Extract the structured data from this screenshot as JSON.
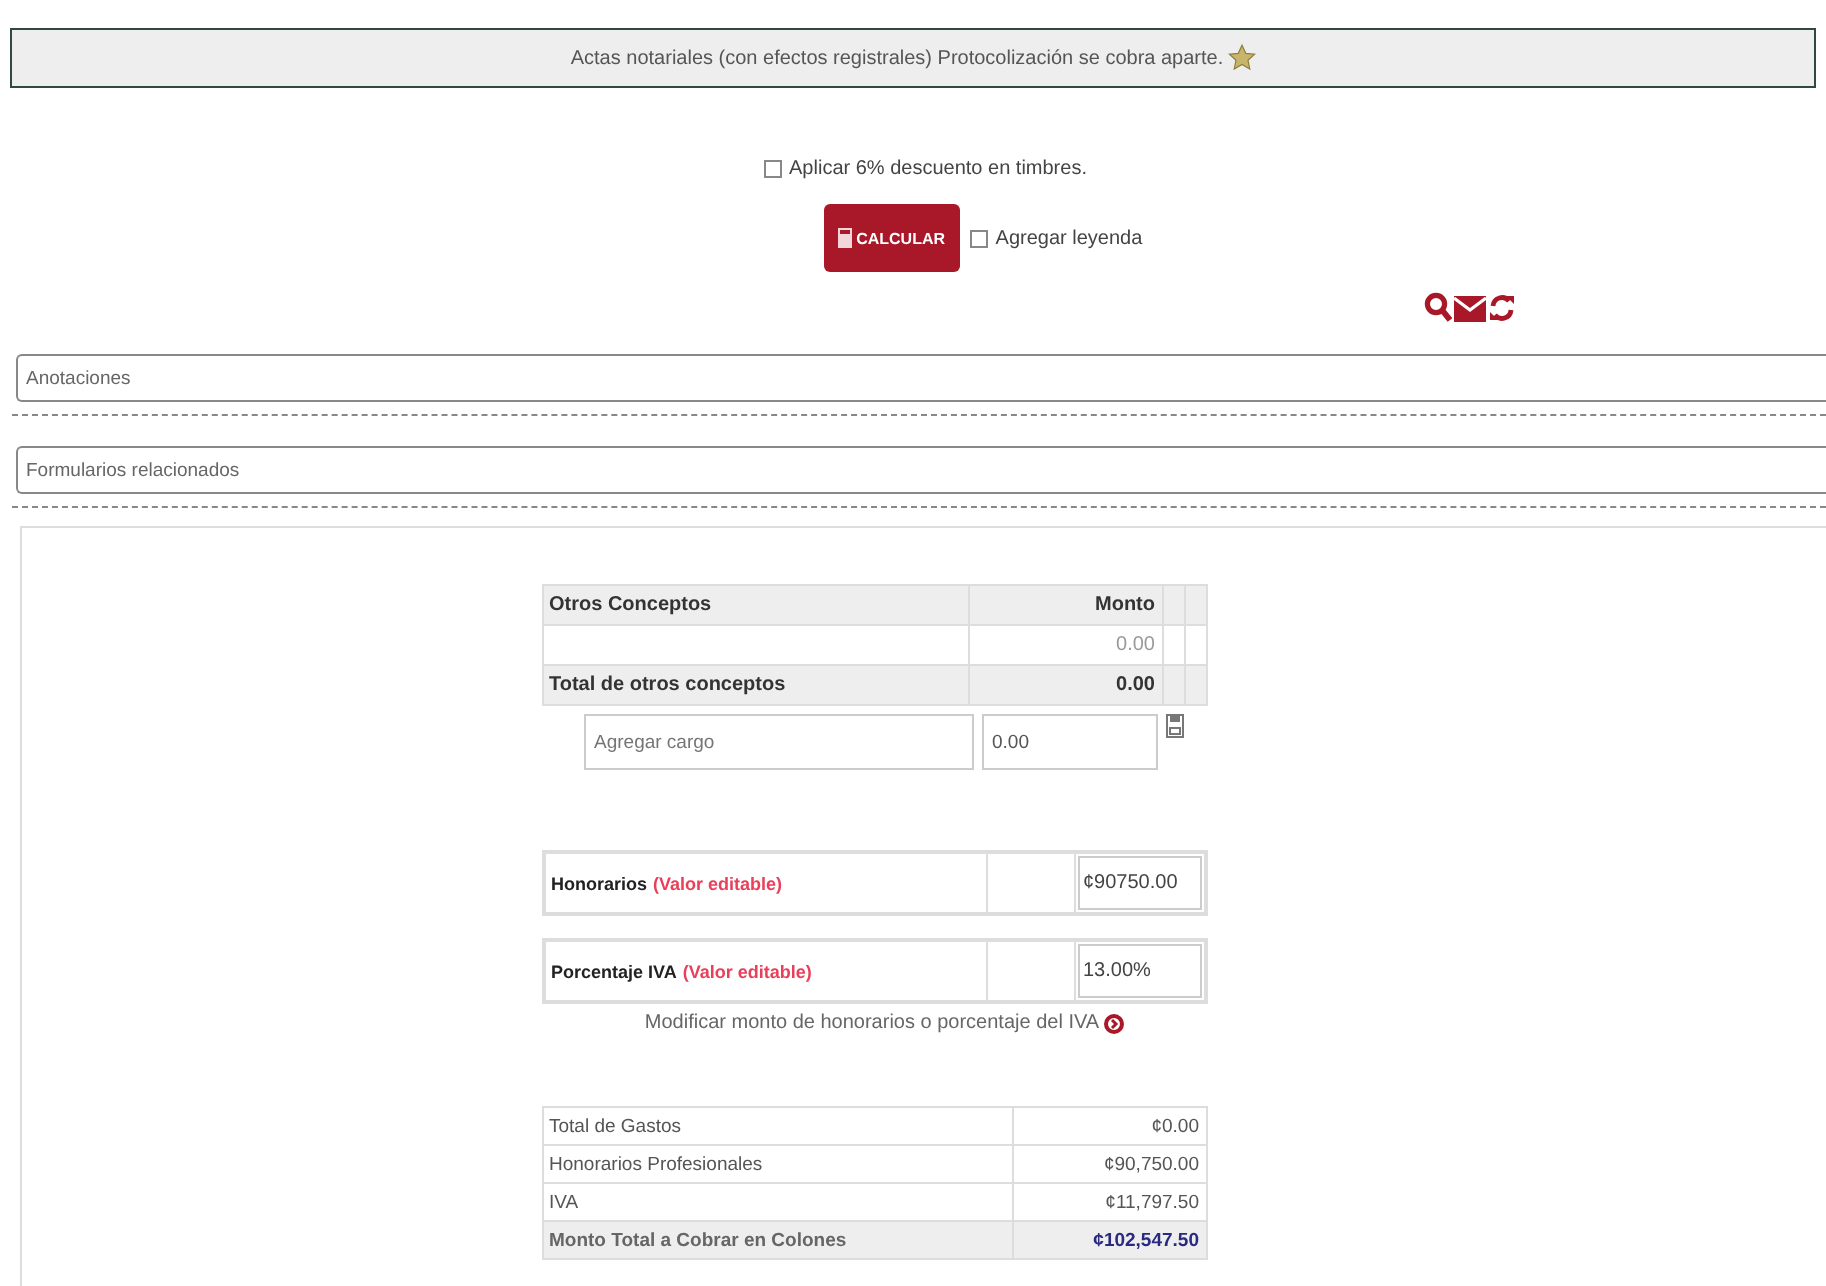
{
  "banner": {
    "text": "Actas notariales (con efectos registrales) Protocolización se cobra aparte."
  },
  "discount": {
    "label": "Aplicar 6% descuento en timbres.",
    "checked": false
  },
  "calculate_button": {
    "label": "CALCULAR"
  },
  "legend": {
    "label": "Agregar leyenda",
    "checked": false
  },
  "sections": [
    {
      "label": "Anotaciones"
    },
    {
      "label": "Formularios relacionados"
    }
  ],
  "other_concepts": {
    "columns": [
      "Otros Conceptos",
      "Monto"
    ],
    "rows": [
      {
        "concept": "",
        "amount": "0.00"
      }
    ],
    "total_label": "Total de otros conceptos",
    "total": "0.00"
  },
  "add_charge": {
    "placeholder": "Agregar cargo",
    "value": "0.00"
  },
  "fees": {
    "label": "Honorarios",
    "note": "(Valor editable)",
    "value": "¢90750.00"
  },
  "vat": {
    "label": "Porcentaje IVA",
    "note": "(Valor editable)",
    "value": "13.00%"
  },
  "modify_hint": "Modificar monto de honorarios o porcentaje del IVA",
  "summary": [
    {
      "label": "Total de Gastos",
      "value": "¢0.00",
      "total": false
    },
    {
      "label": "Honorarios Profesionales",
      "value": "¢90,750.00",
      "total": false
    },
    {
      "label": "IVA",
      "value": "¢11,797.50",
      "total": false
    },
    {
      "label": "Monto Total a Cobrar en Colones",
      "value": "¢102,547.50",
      "total": true
    }
  ]
}
